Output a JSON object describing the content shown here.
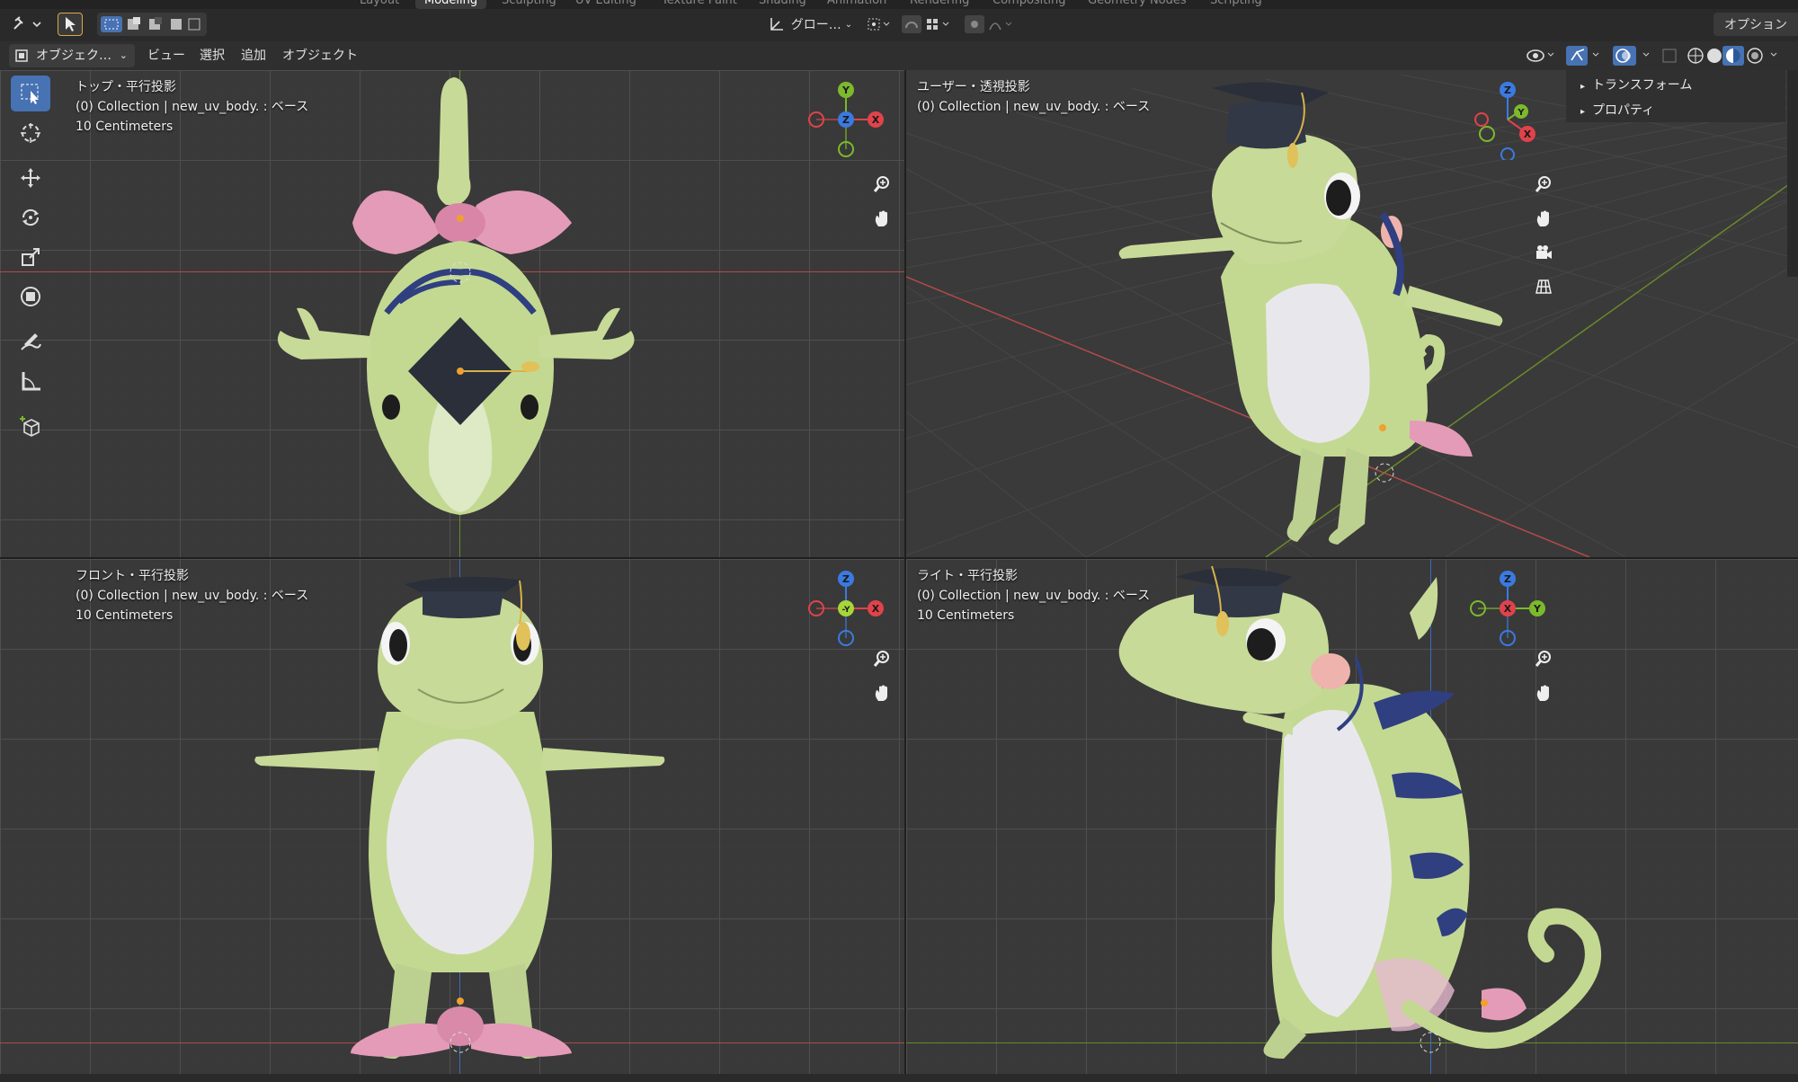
{
  "workspaces": [
    "Layout",
    "Modeling",
    "Sculpting",
    "UV Editing",
    "Texture Paint",
    "Shading",
    "Animation",
    "Rendering",
    "Compositing",
    "Geometry Nodes",
    "Scripting"
  ],
  "active_workspace": "Modeling",
  "tool_header": {
    "transform_orientation": "グロー…",
    "options_label": "オプション"
  },
  "viewport_header": {
    "mode": "オブジェク…",
    "menus": [
      "ビュー",
      "選択",
      "追加",
      "オブジェクト"
    ]
  },
  "sidebar": {
    "items": [
      "トランスフォーム",
      "プロパティ"
    ]
  },
  "viewports": [
    {
      "id": "top",
      "title": "トップ・平行投影",
      "collection": "(0) Collection | new_uv_body. : ベース",
      "scale": "10 Centimeters"
    },
    {
      "id": "user",
      "title": "ユーザー・透視投影",
      "collection": "(0) Collection | new_uv_body. : ベース",
      "scale": ""
    },
    {
      "id": "front",
      "title": "フロント・平行投影",
      "collection": "(0) Collection | new_uv_body. : ベース",
      "scale": "10 Centimeters"
    },
    {
      "id": "right",
      "title": "ライト・平行投影",
      "collection": "(0) Collection | new_uv_body. : ベース",
      "scale": "10 Centimeters"
    }
  ],
  "gizmo_labels": {
    "top": [
      "Y",
      "Z",
      "X"
    ],
    "user": [
      "Z",
      "Y",
      "X"
    ],
    "front": [
      "Z",
      "-Y",
      "X"
    ],
    "right": [
      "Z",
      "X",
      "Y"
    ]
  },
  "colors": {
    "accent": "#4772b3",
    "axis_x": "#e0434b",
    "axis_y": "#7cb92c",
    "axis_z": "#3b7ae0",
    "body": "#c3d992",
    "belly": "#e8e8ec",
    "bow": "#e49bb8",
    "cap": "#2a2f3a",
    "stripe": "#2f3f80"
  }
}
